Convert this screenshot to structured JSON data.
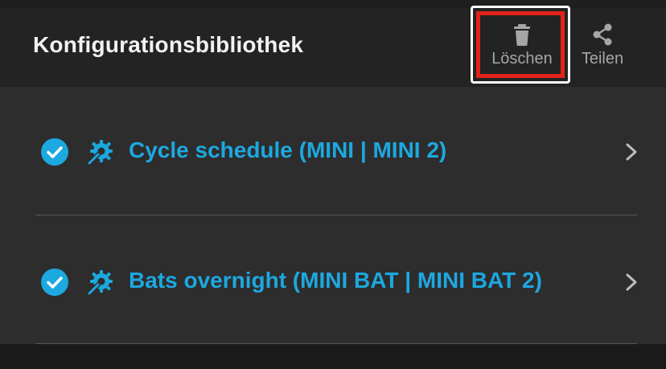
{
  "header": {
    "title": "Konfigurationsbibliothek",
    "actions": {
      "delete": {
        "label": "Löschen",
        "icon": "trash-icon"
      },
      "share": {
        "label": "Teilen",
        "icon": "share-icon"
      }
    }
  },
  "list": {
    "items": [
      {
        "label": "Cycle schedule (MINI | MINI 2)",
        "status_icon": "check-circle-icon",
        "type_icon": "gear-wrench-icon"
      },
      {
        "label": "Bats overnight (MINI BAT | MINI BAT 2)",
        "status_icon": "check-circle-icon",
        "type_icon": "gear-wrench-icon"
      }
    ]
  },
  "colors": {
    "accent": "#1ca8e0",
    "header_bg": "#232323",
    "list_bg": "#2d2d2d",
    "highlight": "#e32219"
  }
}
